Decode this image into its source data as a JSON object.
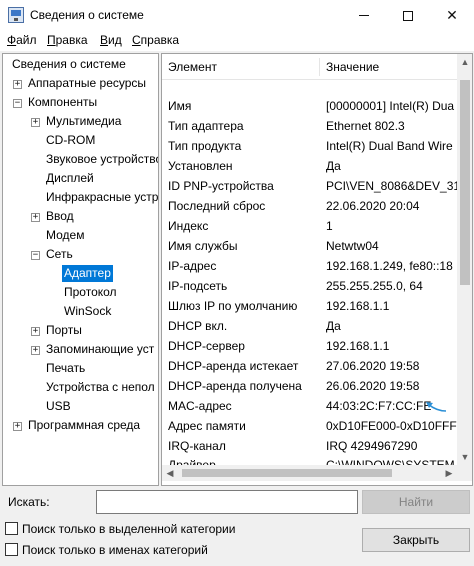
{
  "window": {
    "title": "Сведения о системе",
    "icon": "system-info-icon",
    "controls": {
      "minimize": "minimize-icon",
      "maximize": "maximize-icon",
      "close": "✕"
    }
  },
  "menu": [
    {
      "label": "Файл",
      "accel": "Ф"
    },
    {
      "label": "Правка",
      "accel": "П"
    },
    {
      "label": "Вид",
      "accel": "В"
    },
    {
      "label": "Справка",
      "accel": "С"
    }
  ],
  "tree": {
    "root": "Сведения о системе",
    "nodes": [
      {
        "label": "Аппаратные ресурсы",
        "expander": "+"
      },
      {
        "label": "Компоненты",
        "expander": "−"
      },
      {
        "label": "Мультимедиа",
        "expander": "+"
      },
      {
        "label": "CD-ROM",
        "expander": ""
      },
      {
        "label": "Звуковое устройство",
        "expander": ""
      },
      {
        "label": "Дисплей",
        "expander": ""
      },
      {
        "label": "Инфракрасные устр",
        "expander": ""
      },
      {
        "label": "Ввод",
        "expander": "+"
      },
      {
        "label": "Модем",
        "expander": ""
      },
      {
        "label": "Сеть",
        "expander": "−"
      },
      {
        "label": "Адаптер",
        "expander": "",
        "selected": true
      },
      {
        "label": "Протокол",
        "expander": ""
      },
      {
        "label": "WinSock",
        "expander": ""
      },
      {
        "label": "Порты",
        "expander": "+"
      },
      {
        "label": "Запоминающие уст",
        "expander": "+"
      },
      {
        "label": "Печать",
        "expander": ""
      },
      {
        "label": "Устройства с непол",
        "expander": ""
      },
      {
        "label": "USB",
        "expander": ""
      },
      {
        "label": "Программная среда",
        "expander": "+"
      }
    ]
  },
  "grid": {
    "columns": [
      "Элемент",
      "Значение"
    ],
    "rows": [
      {
        "element": "Имя",
        "value": "[00000001] Intel(R) Dua"
      },
      {
        "element": "Тип адаптера",
        "value": "Ethernet 802.3"
      },
      {
        "element": "Тип продукта",
        "value": "Intel(R) Dual Band Wire"
      },
      {
        "element": "Установлен",
        "value": "Да"
      },
      {
        "element": "ID PNP-устройства",
        "value": "PCI\\VEN_8086&DEV_31"
      },
      {
        "element": "Последний сброс",
        "value": "22.06.2020 20:04"
      },
      {
        "element": "Индекс",
        "value": "1"
      },
      {
        "element": "Имя службы",
        "value": "Netwtw04"
      },
      {
        "element": "IP-адрес",
        "value": "192.168.1.249, fe80::18"
      },
      {
        "element": "IP-подсеть",
        "value": "255.255.255.0, 64"
      },
      {
        "element": "Шлюз IP по умолчанию",
        "value": "192.168.1.1"
      },
      {
        "element": "DHCP вкл.",
        "value": "Да"
      },
      {
        "element": "DHCP-сервер",
        "value": "192.168.1.1"
      },
      {
        "element": "DHCP-аренда истекает",
        "value": "27.06.2020 19:58"
      },
      {
        "element": "DHCP-аренда получена",
        "value": "26.06.2020 19:58"
      },
      {
        "element": "MAC-адрес",
        "value": "44:03:2C:F7:CC:FE"
      },
      {
        "element": "Адрес памяти",
        "value": "0xD10FE000-0xD10FFF"
      },
      {
        "element": "IRQ-канал",
        "value": "IRQ 4294967290"
      },
      {
        "element": "Драйвер",
        "value": "C:\\WINDOWS\\SYSTEM"
      }
    ]
  },
  "search": {
    "label": "Искать:",
    "label_accel": "И",
    "value": "",
    "find_button": "Найти",
    "close_button": "Закрыть",
    "close_accel": "З",
    "checkboxes": [
      {
        "label": "Поиск только в выделенной категории",
        "checked": false
      },
      {
        "label": "Поиск только в именах категорий",
        "checked": false
      }
    ]
  },
  "colors": {
    "selection": "#0078d7",
    "annotation_arrow": "#2b8fd6"
  }
}
